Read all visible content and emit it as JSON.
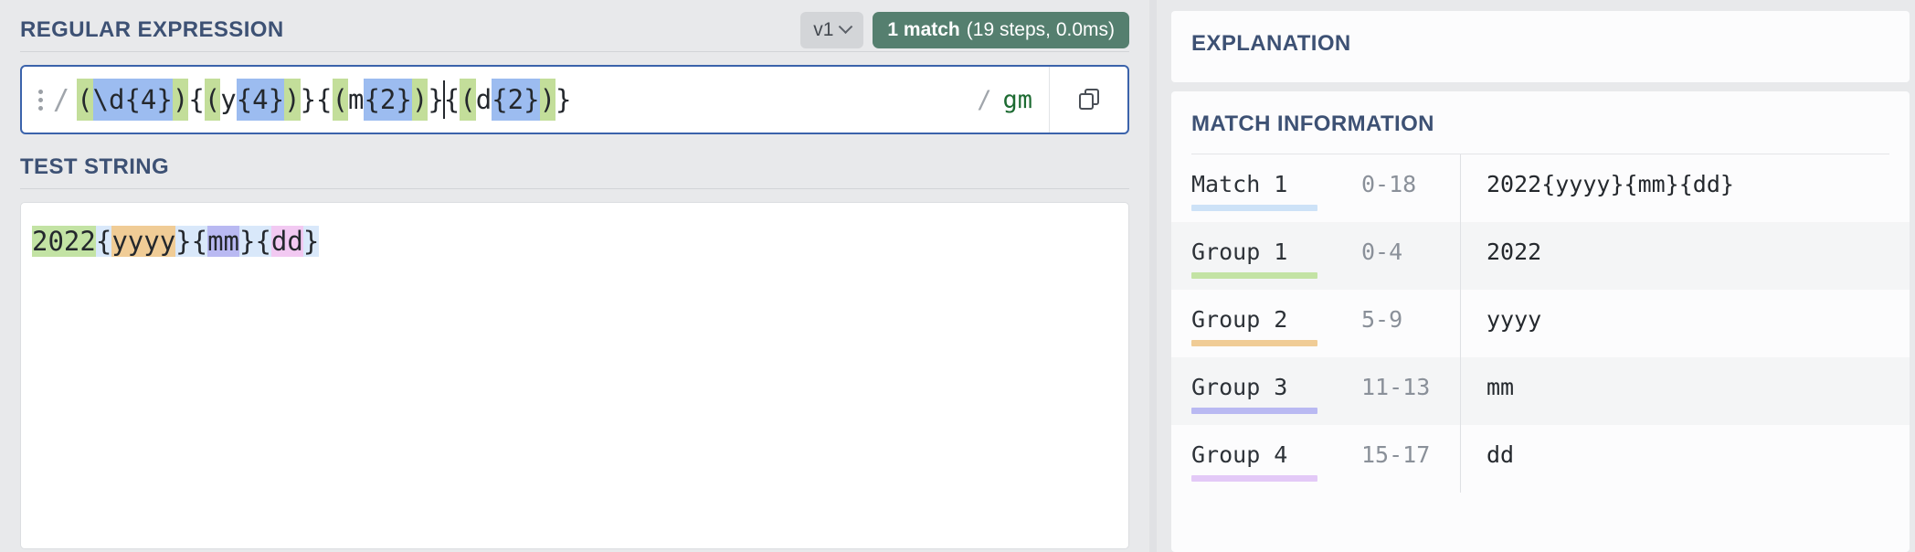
{
  "regex_panel": {
    "title": "REGULAR EXPRESSION",
    "version_label": "v1",
    "version_chevron_icon": "chevron-down-icon",
    "match_badge": {
      "count_text": "1 match",
      "detail_text": "(19 steps, 0.0ms)",
      "color": "#557f6f"
    },
    "drag_handle_icon": "drag-dots-icon",
    "open_delimiter": "/",
    "close_delimiter": "/",
    "flags": "gm",
    "copy_icon": "copy-icon",
    "pattern_plain": "(\\d{4}){(y{4})}{(m{2})}{(d{2})}",
    "pattern_tokens": [
      {
        "text": "(",
        "style": "green"
      },
      {
        "text": "\\d",
        "style": "blue"
      },
      {
        "text": "{4}",
        "style": "blue"
      },
      {
        "text": ")",
        "style": "green"
      },
      {
        "text": "{",
        "style": "plain"
      },
      {
        "text": "(",
        "style": "green"
      },
      {
        "text": "y",
        "style": "plain"
      },
      {
        "text": "{4}",
        "style": "blue"
      },
      {
        "text": ")",
        "style": "green"
      },
      {
        "text": "}",
        "style": "plain"
      },
      {
        "text": "{",
        "style": "plain"
      },
      {
        "text": "(",
        "style": "green"
      },
      {
        "text": "m",
        "style": "plain"
      },
      {
        "text": "{2}",
        "style": "blue"
      },
      {
        "text": ")",
        "style": "green"
      },
      {
        "text": "}",
        "style": "plain"
      },
      {
        "text": "",
        "style": "caret"
      },
      {
        "text": "{",
        "style": "plain"
      },
      {
        "text": "(",
        "style": "green"
      },
      {
        "text": "d",
        "style": "plain"
      },
      {
        "text": "{2}",
        "style": "blue"
      },
      {
        "text": ")",
        "style": "green"
      },
      {
        "text": "}",
        "style": "plain"
      }
    ],
    "highlight_colors": {
      "group_paren": "#c3de9a",
      "quantifier": "#9cbcf0"
    }
  },
  "test_string_panel": {
    "title": "TEST STRING",
    "content_plain": "2022{yyyy}{mm}{dd}",
    "content_tokens": [
      {
        "text": "2022",
        "style": "g1"
      },
      {
        "text": "{",
        "style": "match"
      },
      {
        "text": "yyyy",
        "style": "g2"
      },
      {
        "text": "}{",
        "style": "match"
      },
      {
        "text": "mm",
        "style": "g3"
      },
      {
        "text": "}{",
        "style": "match"
      },
      {
        "text": "dd",
        "style": "g4"
      },
      {
        "text": "}",
        "style": "match"
      }
    ],
    "highlight_colors": {
      "match": "#d9e8fa",
      "group1": "#c3e3a4",
      "group2": "#f0cc96",
      "group3": "#b9b9f2",
      "group4": "#f2c9f2"
    }
  },
  "explanation_panel": {
    "title": "EXPLANATION"
  },
  "match_information_panel": {
    "title": "MATCH INFORMATION",
    "rows": [
      {
        "label": "Match 1",
        "range": "0-18",
        "value": "2022{yyyy}{mm}{dd}",
        "color": "#cde2f7",
        "alt": false
      },
      {
        "label": "Group 1",
        "range": "0-4",
        "value": "2022",
        "color": "#c3e3a4",
        "alt": true
      },
      {
        "label": "Group 2",
        "range": "5-9",
        "value": "yyyy",
        "color": "#f0cc96",
        "alt": false
      },
      {
        "label": "Group 3",
        "range": "11-13",
        "value": "mm",
        "color": "#b9b9f2",
        "alt": true
      },
      {
        "label": "Group 4",
        "range": "15-17",
        "value": "dd",
        "color": "#e3c9f7",
        "alt": false
      }
    ]
  }
}
